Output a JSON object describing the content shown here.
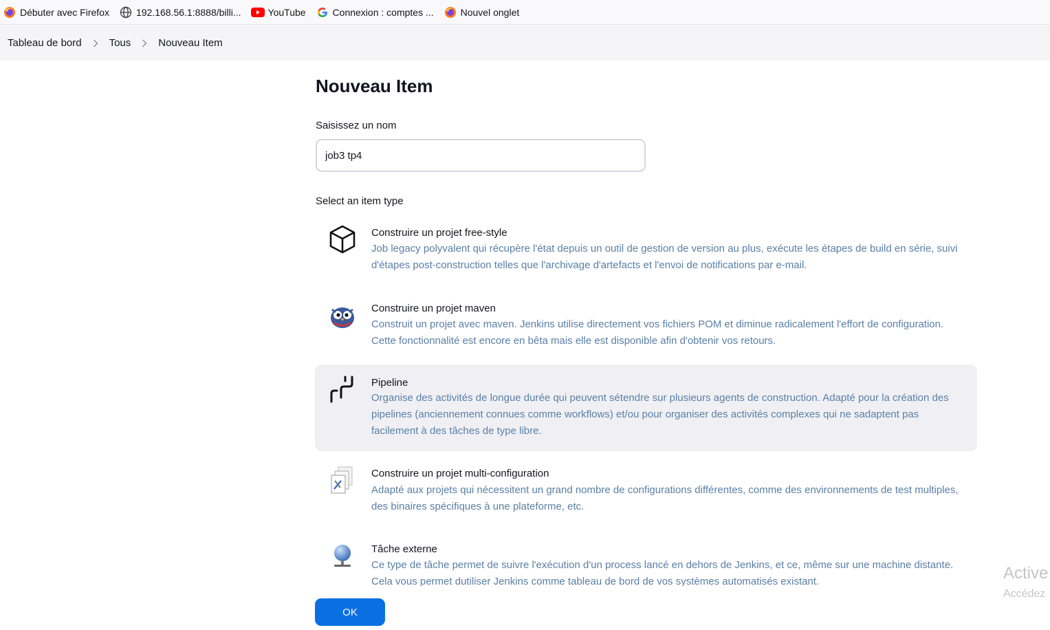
{
  "bookmarks": [
    {
      "label": "Débuter avec Firefox",
      "icon": "firefox-icon"
    },
    {
      "label": "192.168.56.1:8888/billi...",
      "icon": "globe-icon"
    },
    {
      "label": "YouTube",
      "icon": "youtube-icon"
    },
    {
      "label": "Connexion : comptes ...",
      "icon": "google-icon"
    },
    {
      "label": "Nouvel onglet",
      "icon": "firefox-icon"
    }
  ],
  "breadcrumb": [
    "Tableau de bord",
    "Tous",
    "Nouveau Item"
  ],
  "page": {
    "title": "Nouveau Item",
    "name_label": "Saisissez un nom",
    "name_value": "job3 tp4",
    "type_label": "Select an item type"
  },
  "items": [
    {
      "title": "Construire un projet free-style",
      "description": "Job legacy polyvalent qui récupère l'état depuis un outil de gestion de version au plus, exécute les étapes de build en série, suivi d'étapes post-construction telles que l'archivage d'artefacts et l'envoi de notifications par e-mail.",
      "icon": "cube-icon"
    },
    {
      "title": "Construire un projet maven",
      "description": "Construit un projet avec maven. Jenkins utilise directement vos fichiers POM et diminue radicalement l'effort de configuration. Cette fonctionnalité est encore en bêta mais elle est disponible afin d'obtenir vos retours.",
      "icon": "maven-owl-icon"
    },
    {
      "title": "Pipeline",
      "description": "Organise des activités de longue durée qui peuvent sétendre sur plusieurs agents de construction. Adapté pour la création des pipelines (anciennement connues comme workflows) et/ou pour organiser des activités complexes qui ne sadaptent pas facilement à des tâches de type libre.",
      "icon": "pipeline-icon",
      "selected": true
    },
    {
      "title": "Construire un projet multi-configuration",
      "description": "Adapté aux projets qui nécessitent un grand nombre de configurations différentes, comme des environnements de test multiples, des binaires spécifiques à une plateforme, etc.",
      "icon": "multi-config-icon"
    },
    {
      "title": "Tâche externe",
      "description": "Ce type de tâche permet de suivre l'exécution d'un process lancé en dehors de Jenkins, et ce, même sur une machine distante. Cela vous permet dutiliser Jenkins comme tableau de bord de vos systèmes automatisés existant.",
      "icon": "globe-monitor-icon"
    }
  ],
  "ok_label": "OK",
  "watermark": {
    "line1": "Active",
    "line2": "Accédez"
  },
  "colors": {
    "accent": "#0b6fe4",
    "description": "#5a7fa6",
    "selected_bg": "#f0f0f4"
  }
}
